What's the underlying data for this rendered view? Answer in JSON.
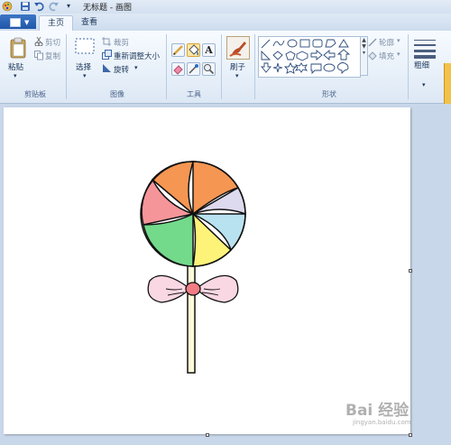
{
  "window": {
    "title": "无标题 - 画图",
    "quick_access": [
      "app-icon",
      "save-icon",
      "undo-icon",
      "redo-icon",
      "customize-icon"
    ]
  },
  "tabs": [
    {
      "label": "主页",
      "active": true
    },
    {
      "label": "查看",
      "active": false
    }
  ],
  "clipboard": {
    "paste_label": "粘贴",
    "cut_label": "剪切",
    "copy_label": "复制",
    "group_label": "剪贴板"
  },
  "image": {
    "select_label": "选择",
    "crop_label": "裁剪",
    "resize_label": "重新调整大小",
    "rotate_label": "旋转",
    "group_label": "图像"
  },
  "tools": {
    "group_label": "工具",
    "items": [
      "pencil-icon",
      "fill-icon",
      "text-icon",
      "eraser-icon",
      "color-picker-icon",
      "magnifier-icon"
    ],
    "selected": "fill-icon"
  },
  "brush": {
    "label": "刷子"
  },
  "shapes": {
    "group_label": "形状",
    "outline_label": "轮廓",
    "fill_label": "填充"
  },
  "size": {
    "label": "粗细"
  },
  "drawing": {
    "subject": "lollipop",
    "slice_colors": [
      "#f59652",
      "#ddd9ee",
      "#b9e2f0",
      "#fdf378",
      "#73d98b",
      "#f69599"
    ],
    "bow_color": "#f9d7e3",
    "knot_color": "#f27c84",
    "stick_color": "#fdfbd8"
  },
  "watermark": {
    "text": "Bai 经验",
    "sub": "jingyan.baidu.com"
  }
}
